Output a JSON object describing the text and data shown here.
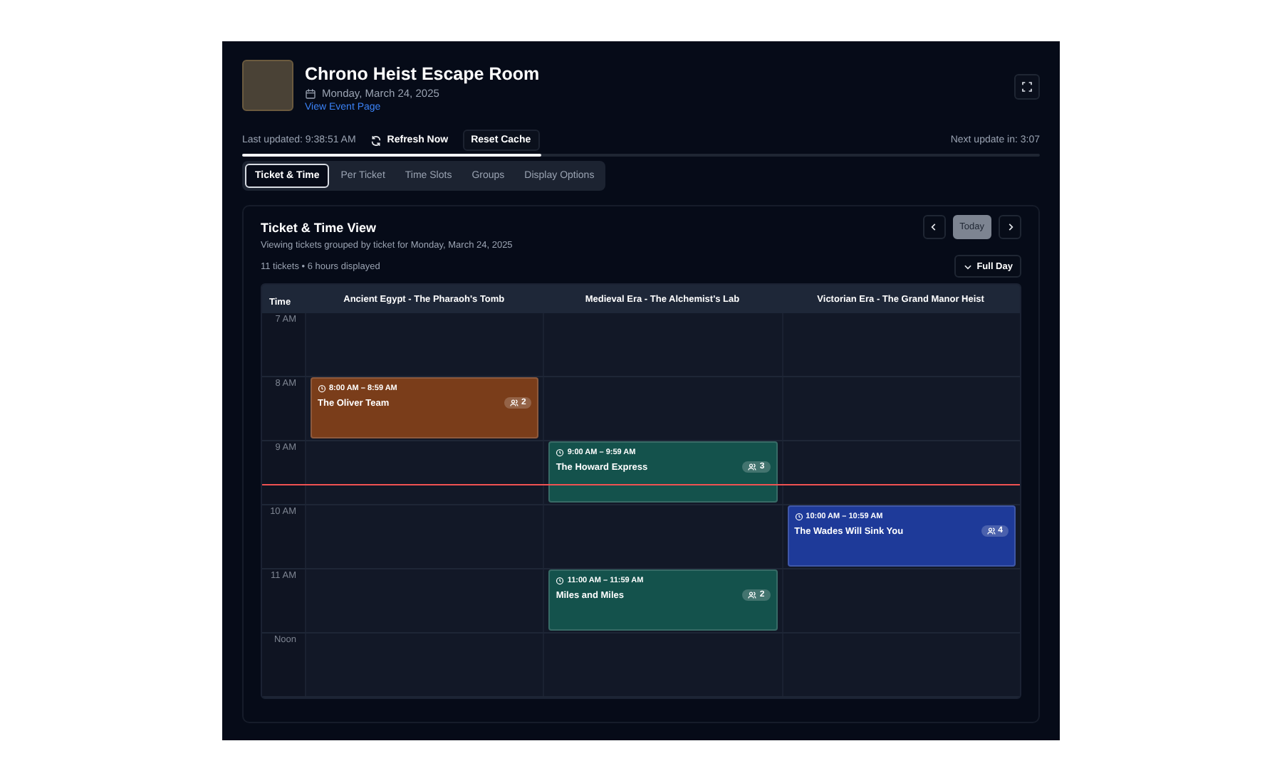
{
  "header": {
    "title": "Chrono Heist Escape Room",
    "date": "Monday, March 24, 2025",
    "link": "View Event Page"
  },
  "status": {
    "last_updated": "Last updated: 9:38:51 AM",
    "refresh": "Refresh Now",
    "reset": "Reset Cache",
    "next_update": "Next update in: 3:07",
    "level": 0.375
  },
  "tabs": [
    {
      "label": "Ticket & Time",
      "selected": true
    },
    {
      "label": "Per Ticket",
      "selected": false
    },
    {
      "label": "Time Slots",
      "selected": false
    },
    {
      "label": "Groups",
      "selected": false
    },
    {
      "label": "Display Options",
      "selected": false
    }
  ],
  "view": {
    "title": "Ticket & Time View",
    "subtitle": "Viewing tickets grouped by ticket for Monday, March 24, 2025",
    "summary": "11 tickets • 6 hours displayed",
    "today": {
      "label": "Today",
      "disabled": true
    },
    "range_button": "Full Day"
  },
  "calendar": {
    "time_heading": "Time",
    "columns": [
      "Ancient Egypt - The Pharaoh's Tomb",
      "Medieval Era - The Alchemist's Lab",
      "Victorian Era - The Grand Manor Heist"
    ],
    "rows": [
      {
        "label": "7 AM",
        "cells": [
          null,
          null,
          null
        ]
      },
      {
        "label": "8 AM",
        "cells": [
          {
            "time": "8:00 AM – 8:59 AM",
            "title": "The Oliver Team",
            "count": "2",
            "color": "#7a3d1a"
          },
          null,
          null
        ]
      },
      {
        "label": "9 AM",
        "cells": [
          null,
          {
            "time": "9:00 AM – 9:59 AM",
            "title": "The Howard Express",
            "count": "3",
            "color": "#14524c"
          },
          null
        ]
      },
      {
        "label": "10 AM",
        "cells": [
          null,
          null,
          {
            "time": "10:00 AM – 10:59 AM",
            "title": "The Wades Will Sink You",
            "count": "4",
            "color": "#1e3a99"
          }
        ]
      },
      {
        "label": "11 AM",
        "cells": [
          null,
          {
            "time": "11:00 AM – 11:59 AM",
            "title": "Miles and Miles",
            "count": "2",
            "color": "#14524c"
          },
          null
        ]
      },
      {
        "label": "Noon",
        "cells": [
          null,
          null,
          null
        ]
      }
    ]
  }
}
